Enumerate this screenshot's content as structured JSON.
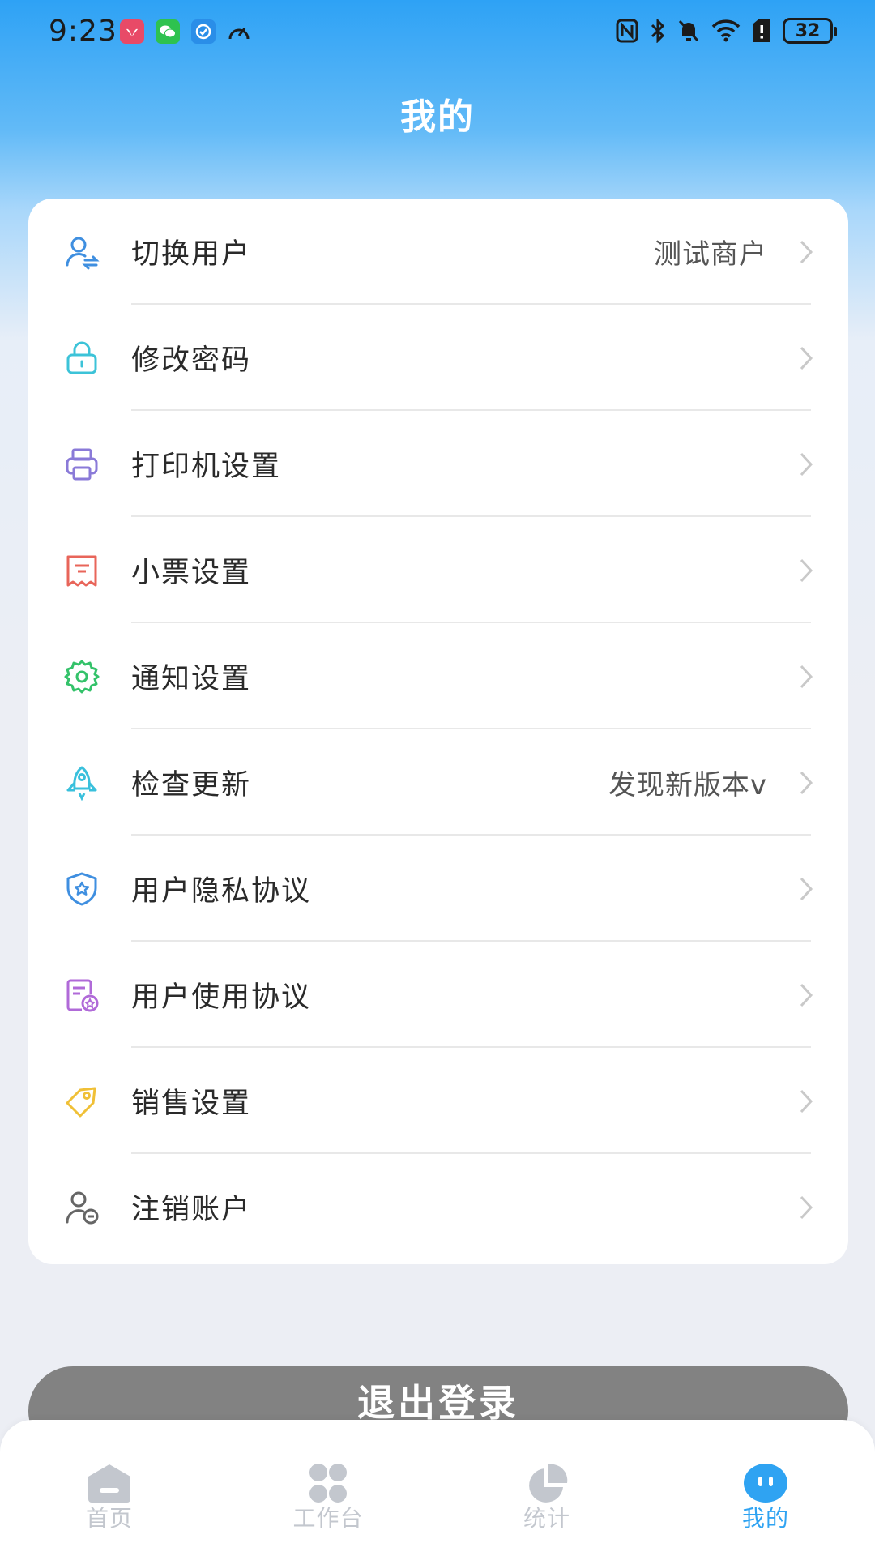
{
  "status_bar": {
    "time": "9:23",
    "battery": "32"
  },
  "page": {
    "title": "我的"
  },
  "menu": {
    "items": [
      {
        "label": "切换用户",
        "value": "测试商户",
        "icon": "user-switch-icon",
        "color": "#3f8fe0"
      },
      {
        "label": "修改密码",
        "value": "",
        "icon": "lock-icon",
        "color": "#3cc3d8"
      },
      {
        "label": "打印机设置",
        "value": "",
        "icon": "printer-icon",
        "color": "#8a7ad8"
      },
      {
        "label": "小票设置",
        "value": "",
        "icon": "receipt-icon",
        "color": "#e8655a"
      },
      {
        "label": "通知设置",
        "value": "",
        "icon": "gear-icon",
        "color": "#34c26a"
      },
      {
        "label": "检查更新",
        "value": "发现新版本v",
        "icon": "rocket-icon",
        "color": "#39c0dc"
      },
      {
        "label": "用户隐私协议",
        "value": "",
        "icon": "shield-icon",
        "color": "#3f8fe0"
      },
      {
        "label": "用户使用协议",
        "value": "",
        "icon": "document-badge-icon",
        "color": "#b06ad8"
      },
      {
        "label": "销售设置",
        "value": "",
        "icon": "tag-icon",
        "color": "#f0c037"
      },
      {
        "label": "注销账户",
        "value": "",
        "icon": "user-remove-icon",
        "color": "#666666"
      }
    ]
  },
  "logout": {
    "label": "退出登录"
  },
  "tabbar": {
    "tabs": [
      {
        "label": "首页",
        "icon": "home-icon"
      },
      {
        "label": "工作台",
        "icon": "grid-icon"
      },
      {
        "label": "统计",
        "icon": "pie-chart-icon"
      },
      {
        "label": "我的",
        "icon": "profile-face-icon"
      }
    ],
    "active_color": "#2fa3f2",
    "inactive_color": "#c3c7ce"
  }
}
